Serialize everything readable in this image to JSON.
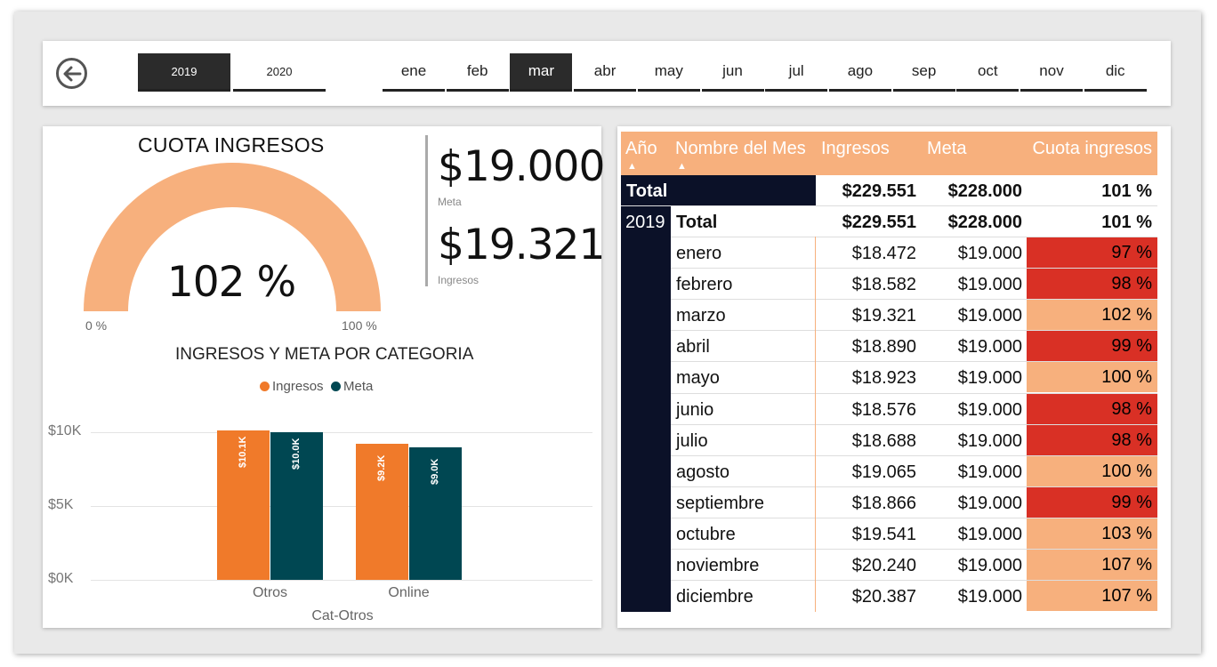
{
  "slicers": {
    "years": [
      "2019",
      "2020"
    ],
    "selected_year": "2019",
    "months": [
      "ene",
      "feb",
      "mar",
      "abr",
      "may",
      "jun",
      "jul",
      "ago",
      "sep",
      "oct",
      "nov",
      "dic"
    ],
    "selected_month": "mar"
  },
  "gauge": {
    "title": "CUOTA INGRESOS",
    "value_label": "102 %",
    "value_percent": 102,
    "min_label": "0 %",
    "max_label": "100 %",
    "color": "#f7b07d"
  },
  "cards": {
    "meta_value": "$19.000",
    "meta_label": "Meta",
    "ingresos_value": "$19.321",
    "ingresos_label": "Ingresos"
  },
  "chart_data": {
    "type": "bar",
    "title": "INGRESOS Y META POR CATEGORIA",
    "xlabel": "Cat-Otros",
    "ylabel": "",
    "categories": [
      "Otros",
      "Online"
    ],
    "series": [
      {
        "name": "Ingresos",
        "values": [
          10.1,
          9.2
        ],
        "labels": [
          "$10.1K",
          "$9.2K"
        ],
        "color": "#f07a2a"
      },
      {
        "name": "Meta",
        "values": [
          10.0,
          9.0
        ],
        "labels": [
          "$10.0K",
          "$9.0K"
        ],
        "color": "#004752"
      }
    ],
    "yticks": [
      "$10K",
      "$5K",
      "$0K"
    ],
    "ylim": [
      0,
      10
    ],
    "grid": true,
    "legend": "top-center"
  },
  "table": {
    "headers": [
      "Año",
      "Nombre del Mes",
      "Ingresos",
      "Meta",
      "Cuota ingresos"
    ],
    "grand_total": {
      "label": "Total",
      "ingresos": "$229.551",
      "meta": "$228.000",
      "cuota": "101 %"
    },
    "year": "2019",
    "year_total": {
      "label": "Total",
      "ingresos": "$229.551",
      "meta": "$228.000",
      "cuota": "101 %"
    },
    "rows": [
      {
        "mes": "enero",
        "ingresos": "$18.472",
        "meta": "$19.000",
        "cuota": "97 %",
        "color": "#d93025"
      },
      {
        "mes": "febrero",
        "ingresos": "$18.582",
        "meta": "$19.000",
        "cuota": "98 %",
        "color": "#d93025"
      },
      {
        "mes": "marzo",
        "ingresos": "$19.321",
        "meta": "$19.000",
        "cuota": "102 %",
        "color": "#f7b07d"
      },
      {
        "mes": "abril",
        "ingresos": "$18.890",
        "meta": "$19.000",
        "cuota": "99 %",
        "color": "#d93025"
      },
      {
        "mes": "mayo",
        "ingresos": "$18.923",
        "meta": "$19.000",
        "cuota": "100 %",
        "color": "#f7b07d"
      },
      {
        "mes": "junio",
        "ingresos": "$18.576",
        "meta": "$19.000",
        "cuota": "98 %",
        "color": "#d93025"
      },
      {
        "mes": "julio",
        "ingresos": "$18.688",
        "meta": "$19.000",
        "cuota": "98 %",
        "color": "#d93025"
      },
      {
        "mes": "agosto",
        "ingresos": "$19.065",
        "meta": "$19.000",
        "cuota": "100 %",
        "color": "#f7b07d"
      },
      {
        "mes": "septiembre",
        "ingresos": "$18.866",
        "meta": "$19.000",
        "cuota": "99 %",
        "color": "#d93025"
      },
      {
        "mes": "octubre",
        "ingresos": "$19.541",
        "meta": "$19.000",
        "cuota": "103 %",
        "color": "#f7b07d"
      },
      {
        "mes": "noviembre",
        "ingresos": "$20.240",
        "meta": "$19.000",
        "cuota": "107 %",
        "color": "#f7b07d"
      },
      {
        "mes": "diciembre",
        "ingresos": "$20.387",
        "meta": "$19.000",
        "cuota": "107 %",
        "color": "#f7b07d"
      }
    ]
  }
}
